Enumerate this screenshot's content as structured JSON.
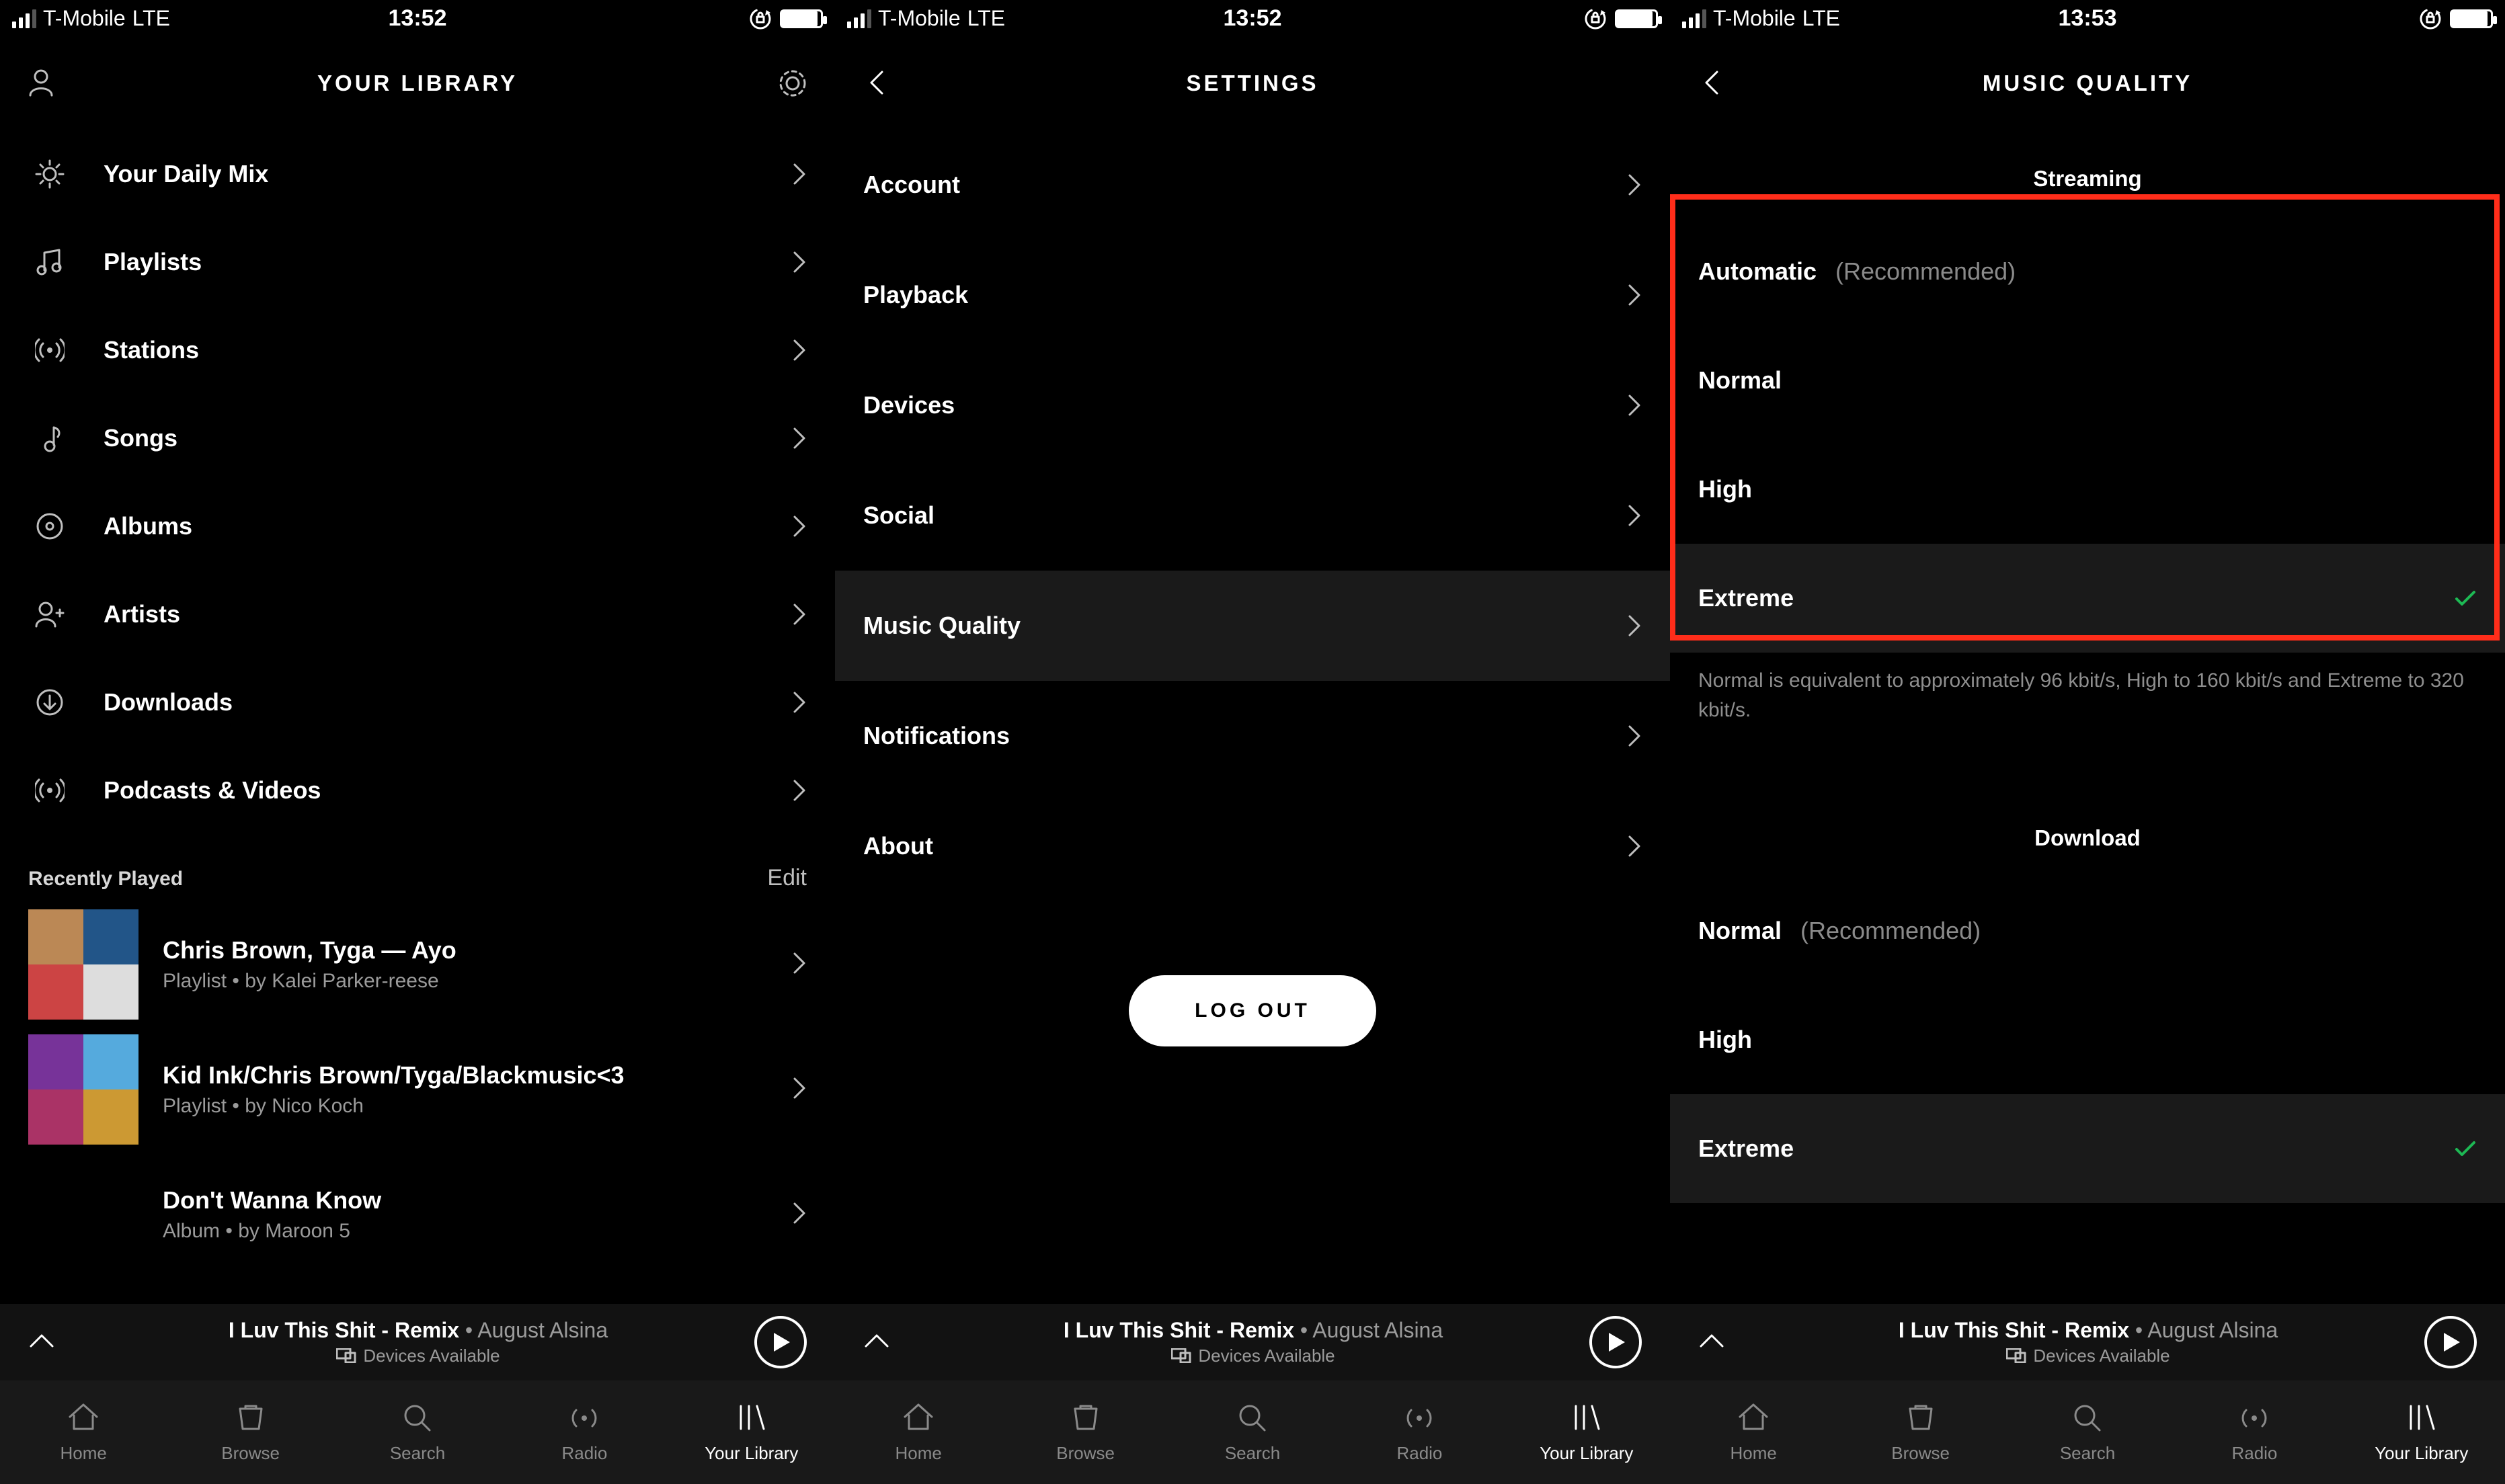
{
  "status": {
    "carrier": "T-Mobile",
    "net": "LTE",
    "time_a": "13:52",
    "time_c": "13:53"
  },
  "pane1": {
    "title": "YOUR LIBRARY",
    "items": [
      {
        "icon": "sun",
        "label": "Your Daily Mix"
      },
      {
        "icon": "note",
        "label": "Playlists"
      },
      {
        "icon": "broadcast",
        "label": "Stations"
      },
      {
        "icon": "note2",
        "label": "Songs"
      },
      {
        "icon": "disc",
        "label": "Albums"
      },
      {
        "icon": "artist",
        "label": "Artists"
      },
      {
        "icon": "download",
        "label": "Downloads"
      },
      {
        "icon": "podcast",
        "label": "Podcasts & Videos"
      }
    ],
    "recent_head": "Recently Played",
    "edit": "Edit",
    "recent": [
      {
        "t1": "Chris Brown, Tyga — Ayo",
        "t2": "Playlist • by Kalei Parker-reese"
      },
      {
        "t1": "Kid Ink/Chris Brown/Tyga/Blackmusic<3",
        "t2": "Playlist • by Nico Koch"
      },
      {
        "t1": "Don't Wanna Know",
        "t2": "Album • by Maroon 5"
      }
    ]
  },
  "pane2": {
    "title": "SETTINGS",
    "items": [
      {
        "label": "Account"
      },
      {
        "label": "Playback"
      },
      {
        "label": "Devices"
      },
      {
        "label": "Social"
      },
      {
        "label": "Music Quality",
        "selected": true
      },
      {
        "label": "Notifications"
      },
      {
        "label": "About"
      }
    ],
    "logout": "LOG OUT"
  },
  "pane3": {
    "title": "MUSIC QUALITY",
    "sec_stream": "Streaming",
    "stream": [
      {
        "label": "Automatic",
        "suffix": "(Recommended)"
      },
      {
        "label": "Normal"
      },
      {
        "label": "High"
      },
      {
        "label": "Extreme",
        "checked": true
      }
    ],
    "hint": "Normal is equivalent to approximately 96 kbit/s, High to 160 kbit/s and Extreme to 320 kbit/s.",
    "sec_download": "Download",
    "download": [
      {
        "label": "Normal",
        "suffix": "(Recommended)"
      },
      {
        "label": "High"
      },
      {
        "label": "Extreme",
        "checked": true
      }
    ]
  },
  "now": {
    "song": "I Luv This Shit - Remix",
    "sep": " • ",
    "artist": "August Alsina",
    "devices": "Devices Available"
  },
  "tabs": [
    {
      "label": "Home"
    },
    {
      "label": "Browse"
    },
    {
      "label": "Search"
    },
    {
      "label": "Radio"
    },
    {
      "label": "Your Library",
      "active": true
    }
  ]
}
